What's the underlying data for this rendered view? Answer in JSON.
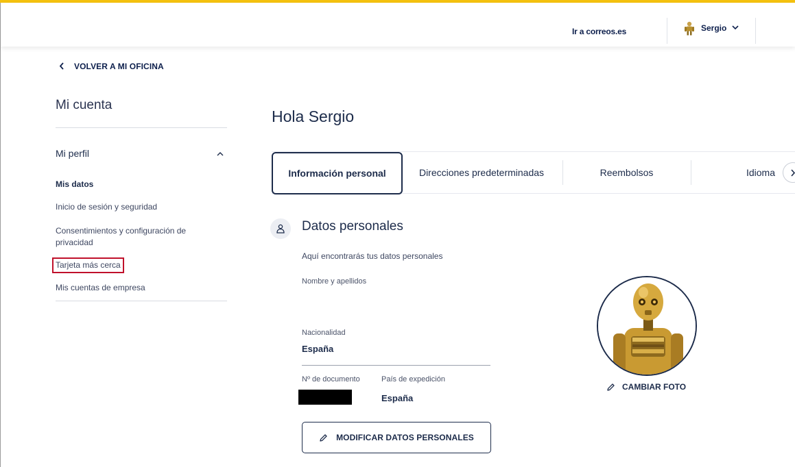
{
  "header": {
    "link_label": "Ir a correos.es",
    "user_name": "Sergio"
  },
  "back": {
    "label": "VOLVER A MI OFICINA"
  },
  "sidebar": {
    "title": "Mi cuenta",
    "section_label": "Mi perfil",
    "items": [
      {
        "label": "Mis datos",
        "state": "active"
      },
      {
        "label": "Inicio de sesión y seguridad"
      },
      {
        "label": "Consentimientos y configuración de privacidad"
      },
      {
        "label": "Tarjeta más cerca",
        "state": "highlighted"
      },
      {
        "label": "Mis cuentas de empresa"
      }
    ]
  },
  "main": {
    "greeting": "Hola Sergio",
    "tabs": [
      {
        "label": "Información personal",
        "active": true
      },
      {
        "label": "Direcciones predeterminadas"
      },
      {
        "label": "Reembolsos"
      },
      {
        "label": "Idioma"
      }
    ],
    "section": {
      "title": "Datos personales",
      "subtitle": "Aquí encontrarás tus datos personales",
      "name_label": "Nombre y apellidos",
      "nationality_label": "Nacionalidad",
      "nationality_value": "España",
      "document_label": "Nº de documento",
      "country_label": "País de expedición",
      "country_value": "España",
      "modify_button": "MODIFICAR DATOS PERSONALES",
      "change_photo_button": "CAMBIAR FOTO"
    }
  },
  "colors": {
    "brand_yellow": "#f4c10f",
    "navy": "#1c2b4a",
    "highlight_red": "#c0102a"
  },
  "icons": [
    "chevron-left-icon",
    "chevron-down-icon",
    "chevron-up-icon",
    "chevron-right-icon",
    "user-icon",
    "pencil-icon",
    "avatar-robot"
  ]
}
